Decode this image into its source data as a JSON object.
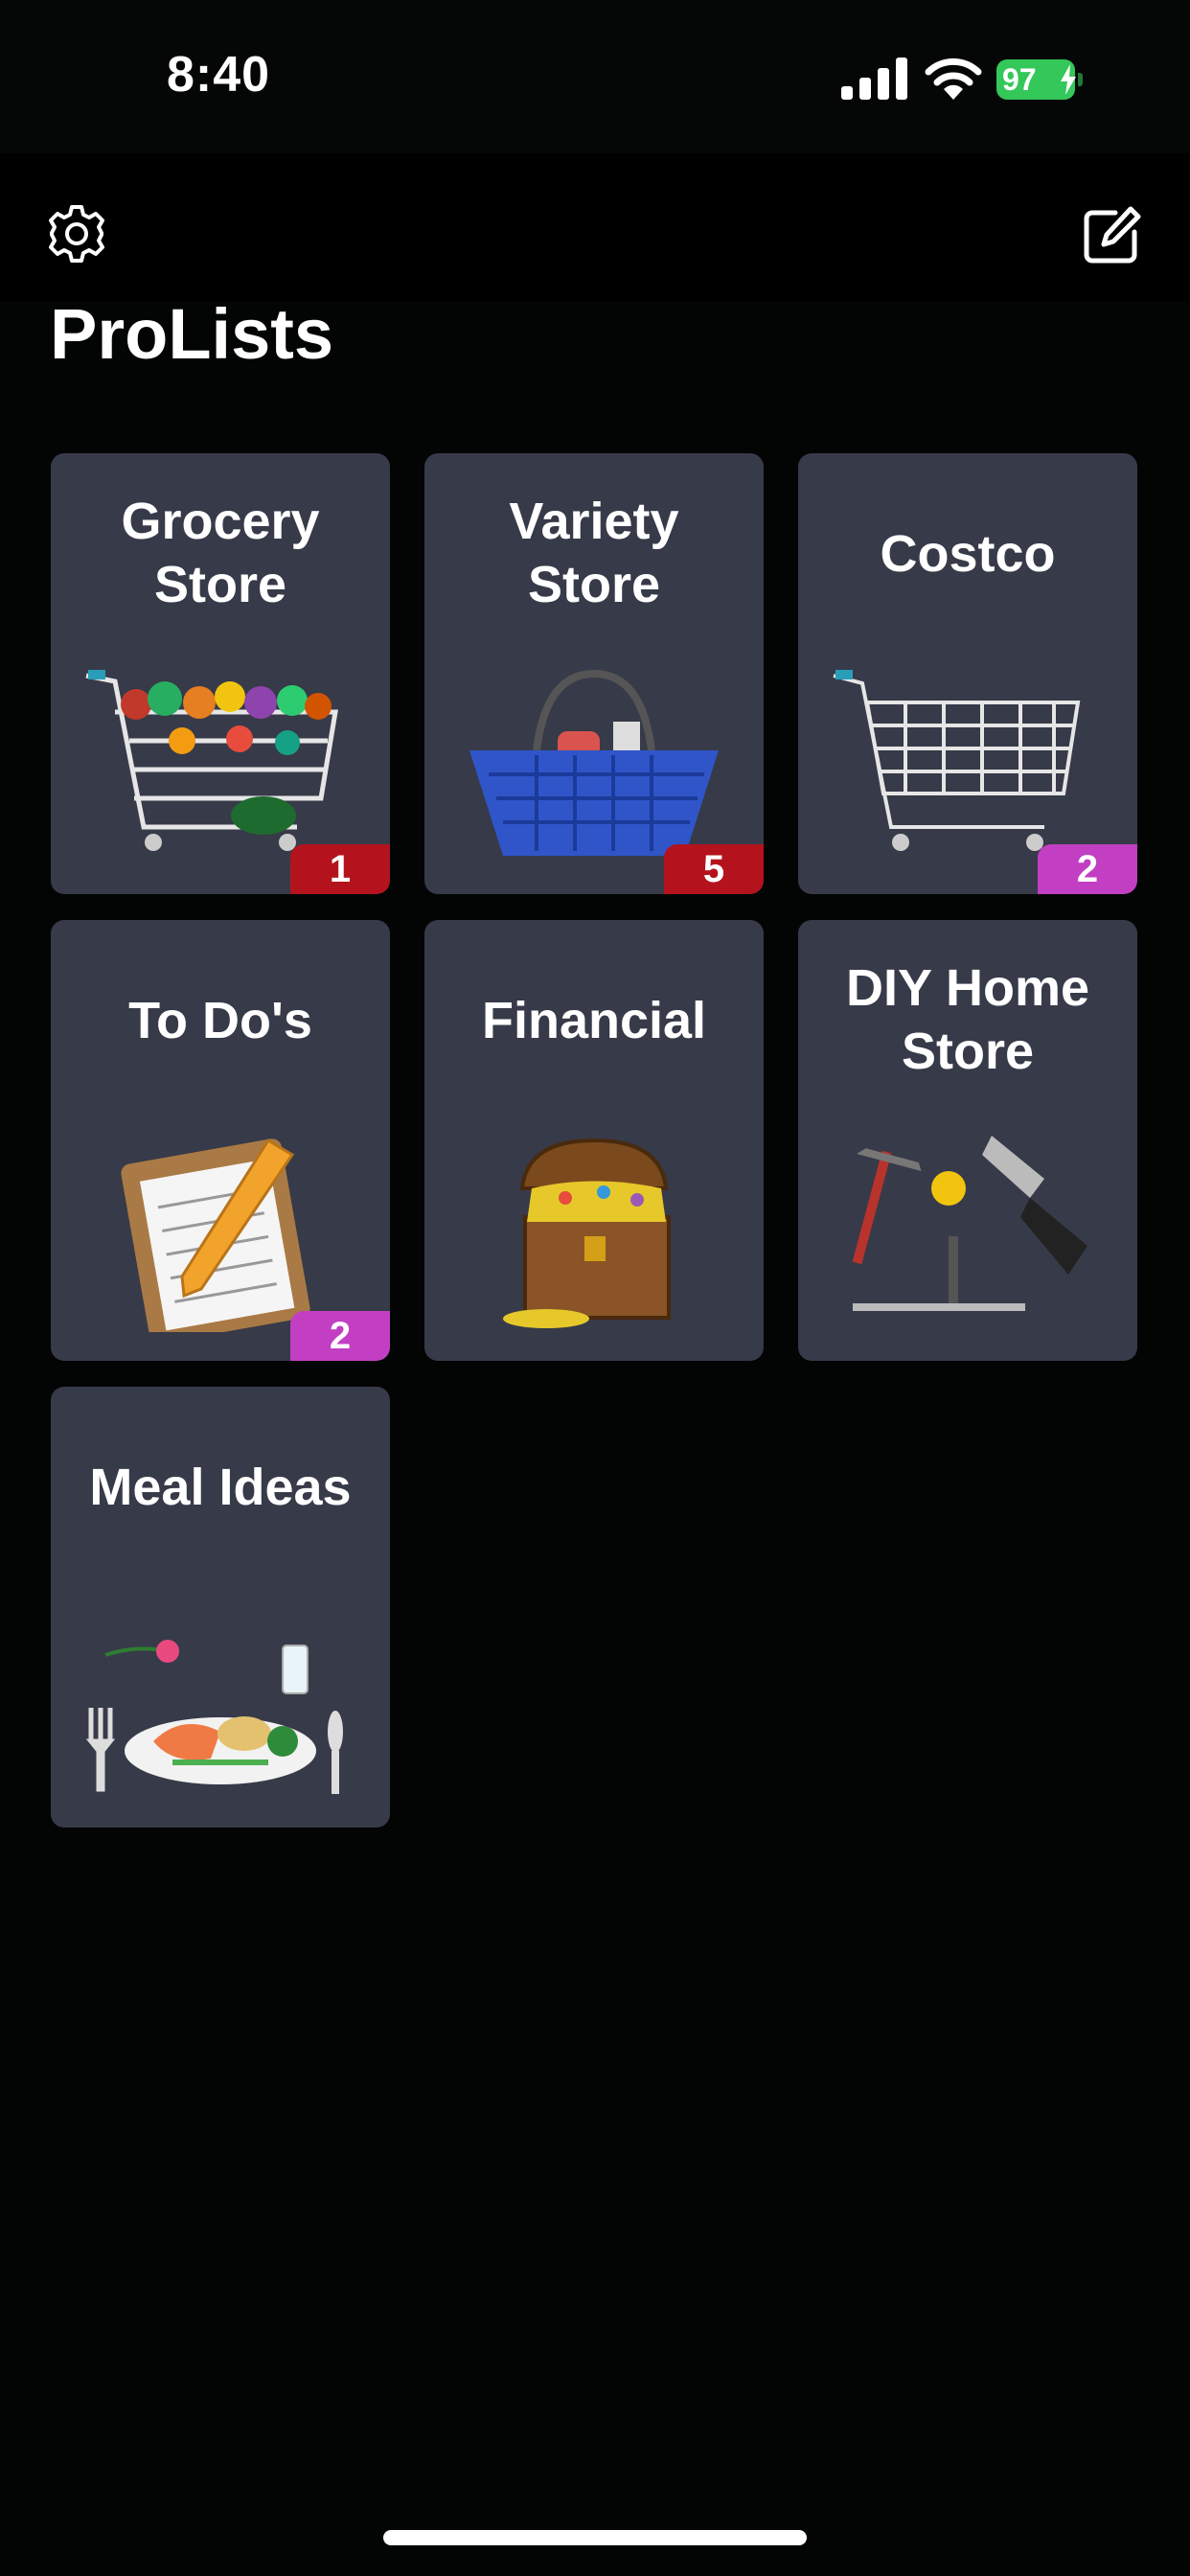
{
  "status_bar": {
    "time": "8:40",
    "battery_level": "97",
    "battery_color": "#34c759",
    "icons": [
      "signal-icon",
      "wifi-icon",
      "battery-icon",
      "charging-bolt-icon"
    ]
  },
  "nav": {
    "left_icon": "gear-icon",
    "right_icon": "compose-icon"
  },
  "page_title": "ProLists",
  "lists": [
    {
      "title_line1": "Grocery",
      "title_line2": "Store",
      "icon": "grocery-cart-icon",
      "badge": "1",
      "badge_color": "#b4131e"
    },
    {
      "title_line1": "Variety",
      "title_line2": "Store",
      "icon": "shopping-basket-icon",
      "badge": "5",
      "badge_color": "#b4131e"
    },
    {
      "title_line1": "Costco",
      "title_line2": "",
      "icon": "empty-cart-icon",
      "badge": "2",
      "badge_color": "#c23fc4"
    },
    {
      "title_line1": "To Do's",
      "title_line2": "",
      "icon": "clipboard-pencil-icon",
      "badge": "2",
      "badge_color": "#c23fc4"
    },
    {
      "title_line1": "Financial",
      "title_line2": "",
      "icon": "treasure-chest-icon",
      "badge": "",
      "badge_color": ""
    },
    {
      "title_line1": "DIY Home",
      "title_line2": "Store",
      "icon": "tools-icon",
      "badge": "",
      "badge_color": ""
    },
    {
      "title_line1": "Meal Ideas",
      "title_line2": "",
      "icon": "meal-plate-icon",
      "badge": "",
      "badge_color": ""
    }
  ],
  "colors": {
    "background": "#030505",
    "tile": "#373a48",
    "badge_red": "#b4131e",
    "badge_purple": "#c23fc4"
  }
}
